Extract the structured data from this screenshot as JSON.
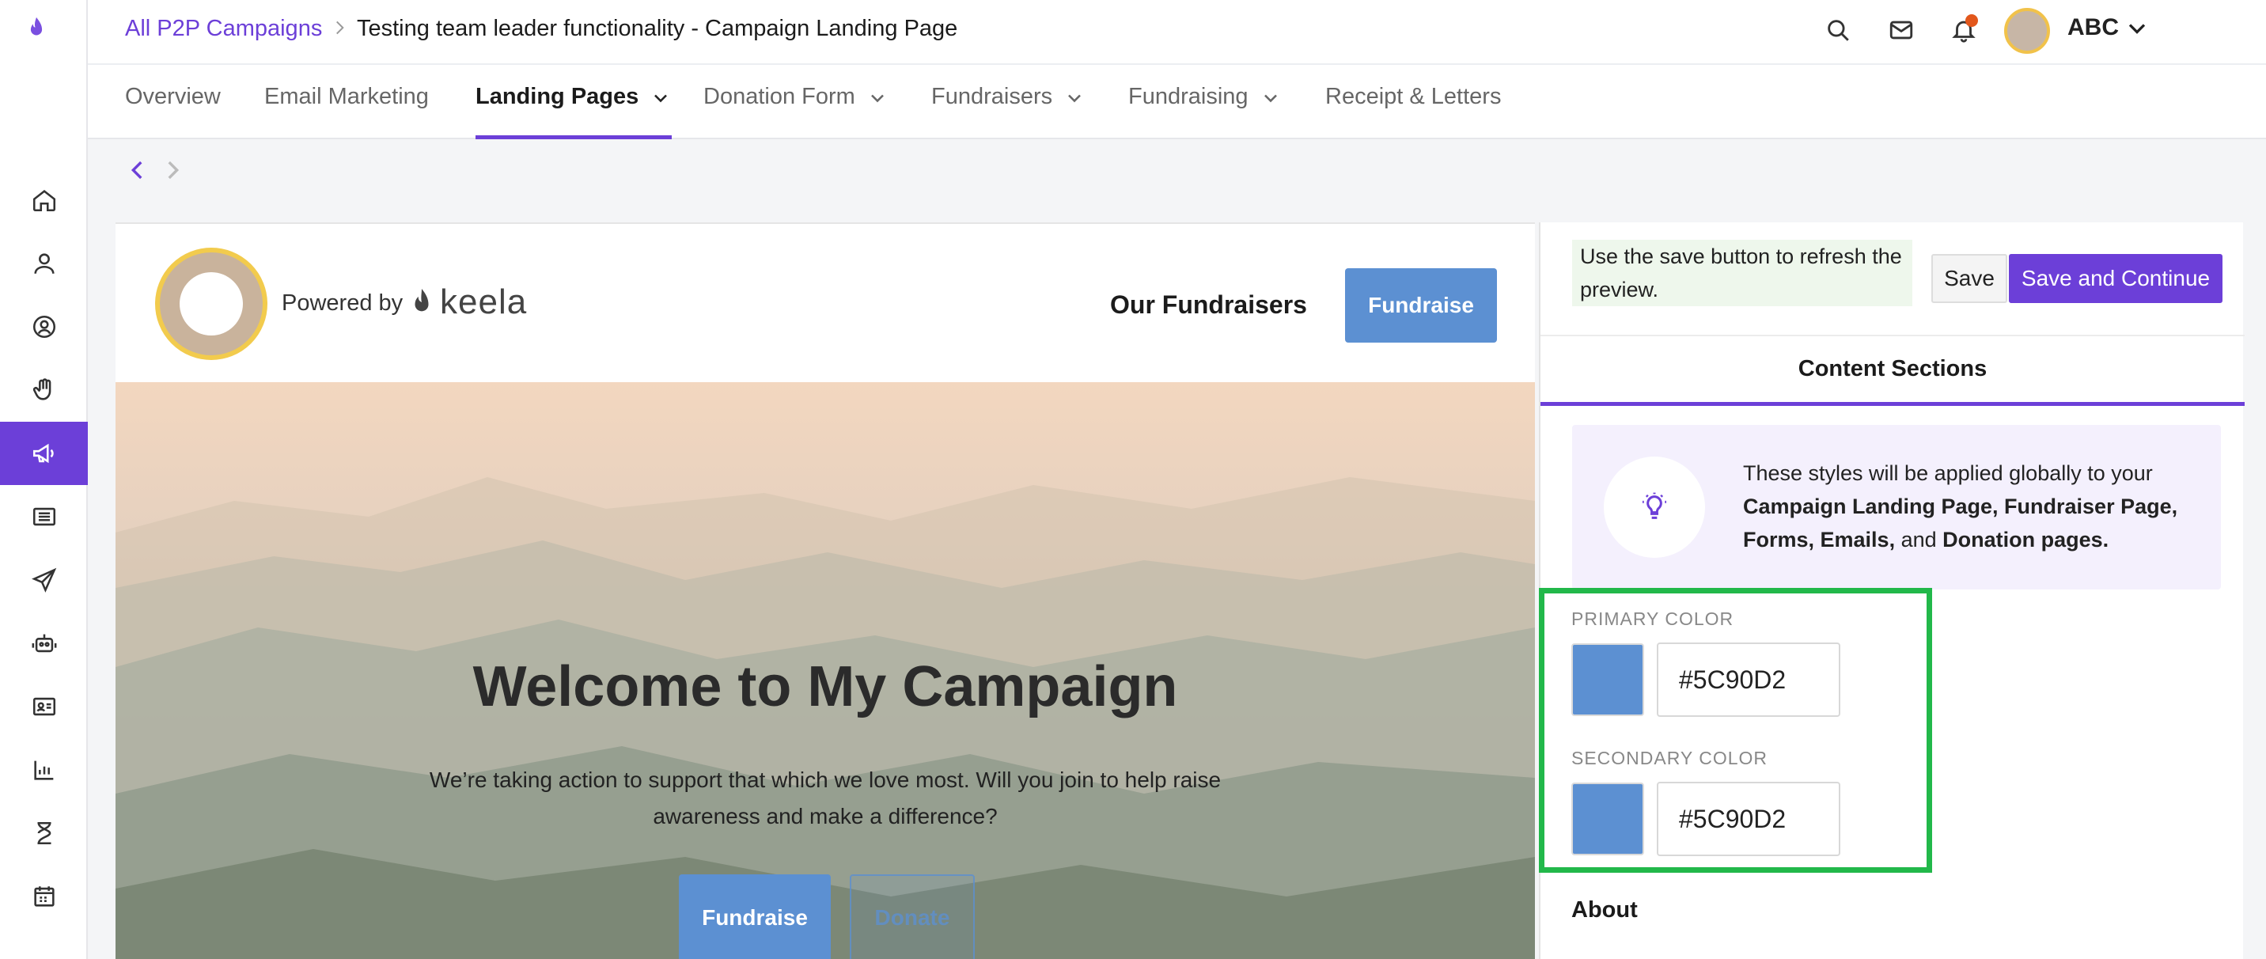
{
  "breadcrumb": {
    "link": "All P2P Campaigns",
    "title": "Testing team leader functionality - Campaign Landing Page"
  },
  "user": {
    "name": "ABC"
  },
  "tabs": [
    {
      "label": "Overview"
    },
    {
      "label": "Email Marketing"
    },
    {
      "label": "Landing Pages"
    },
    {
      "label": "Donation Form"
    },
    {
      "label": "Fundraisers"
    },
    {
      "label": "Fundraising"
    },
    {
      "label": "Receipt & Letters"
    }
  ],
  "preview": {
    "powered_by": "Powered by",
    "brand": "keela",
    "nav_link": "Our Fundraisers",
    "header_button": "Fundraise",
    "hero_title": "Welcome to My Campaign",
    "hero_text": "We’re taking action to support that which we love most. Will you join to help raise awareness and make a difference?",
    "hero_button_primary": "Fundraise",
    "hero_button_secondary": "Donate"
  },
  "panel": {
    "save_note": "Use the save button to refresh the preview.",
    "save_label": "Save",
    "save_continue_label": "Save and Continue",
    "section_tab": "Content Sections",
    "info_prefix": "These styles will be applied globally to your ",
    "info_bold1": "Campaign Landing Page, Fundraiser Page, Forms, Emails,",
    "info_and": " and ",
    "info_bold2": "Donation pages.",
    "primary_label": "PRIMARY COLOR",
    "primary_value": "#5C90D2",
    "secondary_label": "SECONDARY COLOR",
    "secondary_value": "#5C90D2",
    "about_label": "About"
  },
  "colors": {
    "accent": "#6c3fd8",
    "primary": "#5C90D2",
    "secondary": "#5C90D2",
    "highlight": "#22b84a"
  }
}
